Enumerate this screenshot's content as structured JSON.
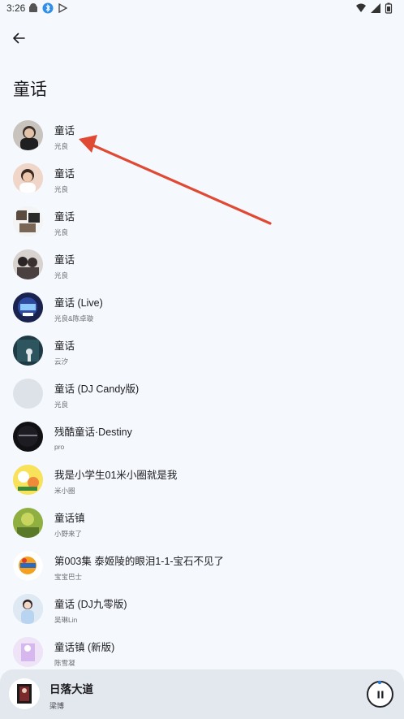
{
  "status_bar": {
    "time": "3:26"
  },
  "header": {
    "title": "童话"
  },
  "songs": [
    {
      "title": "童话",
      "artist": "光良"
    },
    {
      "title": "童话",
      "artist": "光良"
    },
    {
      "title": "童话",
      "artist": "光良"
    },
    {
      "title": "童话",
      "artist": "光良"
    },
    {
      "title": "童话 (Live)",
      "artist": "光良&陈卓璇"
    },
    {
      "title": "童话",
      "artist": "云汐"
    },
    {
      "title": "童话 (DJ Candy版)",
      "artist": "光良"
    },
    {
      "title": "残酷童话·Destiny",
      "artist": "pro"
    },
    {
      "title": "我是小学生01米小圈就是我",
      "artist": "米小圈"
    },
    {
      "title": "童话镇",
      "artist": "小野来了"
    },
    {
      "title": "第003集 泰姬陵的眼泪1-1-宝石不见了",
      "artist": "宝宝巴士"
    },
    {
      "title": "童话 (DJ九零版)",
      "artist": "吴琳Lin"
    },
    {
      "title": "童话镇 (新版)",
      "artist": "陈雪凝"
    }
  ],
  "mini_player": {
    "title": "日落大道",
    "artist": "梁博"
  },
  "colors": {
    "background": "#f5f9fd",
    "annotation_arrow": "#e04a35",
    "player_bg": "#e3e8ee"
  }
}
